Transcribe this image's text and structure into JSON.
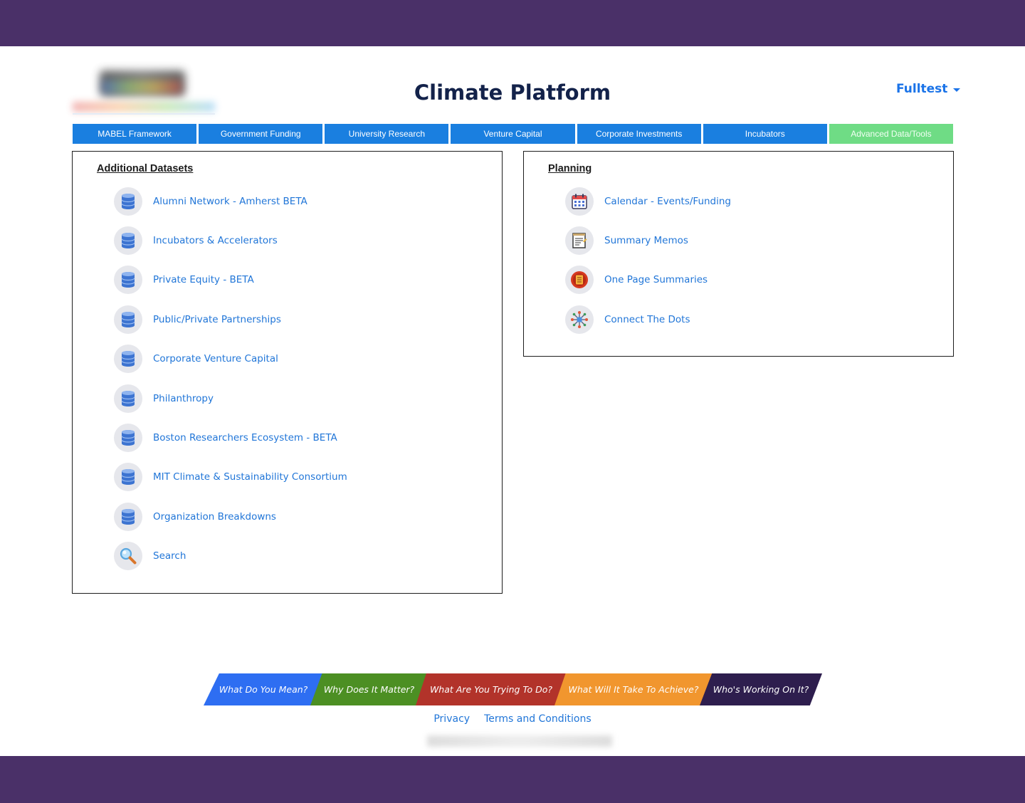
{
  "header": {
    "title": "Climate Platform",
    "user_menu": "Fulltest",
    "logo_text": "MABEL"
  },
  "nav": {
    "tabs": [
      {
        "label": "MABEL Framework",
        "active": false
      },
      {
        "label": "Government Funding",
        "active": false
      },
      {
        "label": "University Research",
        "active": false
      },
      {
        "label": "Venture Capital",
        "active": false
      },
      {
        "label": "Corporate Investments",
        "active": false
      },
      {
        "label": "Incubators",
        "active": false
      },
      {
        "label": "Advanced Data/Tools",
        "active": true
      }
    ]
  },
  "datasets": {
    "heading": "Additional Datasets",
    "items": [
      {
        "label": "Alumni Network - Amherst BETA",
        "icon": "database-icon"
      },
      {
        "label": "Incubators & Accelerators",
        "icon": "database-icon"
      },
      {
        "label": "Private Equity - BETA",
        "icon": "database-icon"
      },
      {
        "label": "Public/Private Partnerships",
        "icon": "database-icon"
      },
      {
        "label": "Corporate Venture Capital",
        "icon": "database-icon"
      },
      {
        "label": "Philanthropy",
        "icon": "database-icon"
      },
      {
        "label": "Boston Researchers Ecosystem - BETA",
        "icon": "database-icon"
      },
      {
        "label": "MIT Climate & Sustainability Consortium",
        "icon": "database-icon"
      },
      {
        "label": "Organization Breakdowns",
        "icon": "database-icon"
      },
      {
        "label": "Search",
        "icon": "magnifier-icon"
      }
    ]
  },
  "planning": {
    "heading": "Planning",
    "items": [
      {
        "label": "Calendar - Events/Funding",
        "icon": "calendar-icon"
      },
      {
        "label": "Summary Memos",
        "icon": "memo-icon"
      },
      {
        "label": "One Page Summaries",
        "icon": "document-icon"
      },
      {
        "label": "Connect The Dots",
        "icon": "network-icon"
      }
    ]
  },
  "questions": [
    {
      "label": "What Do You Mean?",
      "color": "#2e6ef2"
    },
    {
      "label": "Why Does It Matter?",
      "color": "#4c8f23"
    },
    {
      "label": "What Are You Trying To Do?",
      "color": "#b2332a"
    },
    {
      "label": "What Will It Take To Achieve?",
      "color": "#f1962e"
    },
    {
      "label": "Who's Working On It?",
      "color": "#2e1e4e"
    }
  ],
  "footer": {
    "privacy": "Privacy",
    "terms": "Terms and Conditions"
  },
  "colors": {
    "frame": "#4a3068",
    "nav_tab": "#1a7fe0",
    "nav_tab_active": "#6fdc85",
    "link": "#2176d8",
    "title": "#13224a"
  }
}
